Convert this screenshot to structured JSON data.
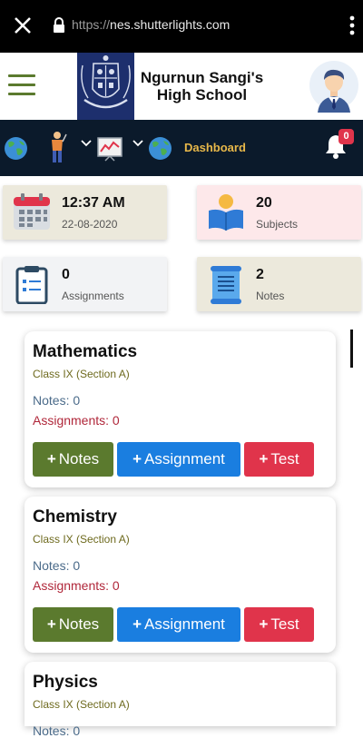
{
  "browser": {
    "url_scheme": "https://",
    "url_host": "nes.shutterlights.com"
  },
  "header": {
    "school_line1": "Ngurnun Sangi's",
    "school_line2": "High School"
  },
  "nav": {
    "dashboard_label": "Dashboard",
    "notification_count": "0"
  },
  "stats": {
    "time": {
      "value": "12:37 AM",
      "label": "22-08-2020"
    },
    "subjects": {
      "value": "20",
      "label": "Subjects"
    },
    "assignments": {
      "value": "0",
      "label": "Assignments"
    },
    "notes": {
      "value": "2",
      "label": "Notes"
    }
  },
  "subjects": [
    {
      "name": "Mathematics",
      "class": "Class IX (Section A)",
      "notes": "Notes: 0",
      "assignments": "Assignments: 0",
      "btn_notes": "Notes",
      "btn_assignment": "Assignment",
      "btn_test": "Test"
    },
    {
      "name": "Chemistry",
      "class": "Class IX (Section A)",
      "notes": "Notes: 0",
      "assignments": "Assignments: 0",
      "btn_notes": "Notes",
      "btn_assignment": "Assignment",
      "btn_test": "Test"
    },
    {
      "name": "Physics",
      "class": "Class IX (Section A)",
      "notes": "Notes: 0"
    }
  ],
  "colors": {
    "olive": "#5b7a2e",
    "blue": "#1a7ee0",
    "red": "#e0344b",
    "nav_bg": "#0b1a2b",
    "accent_gold": "#e8b84a"
  }
}
